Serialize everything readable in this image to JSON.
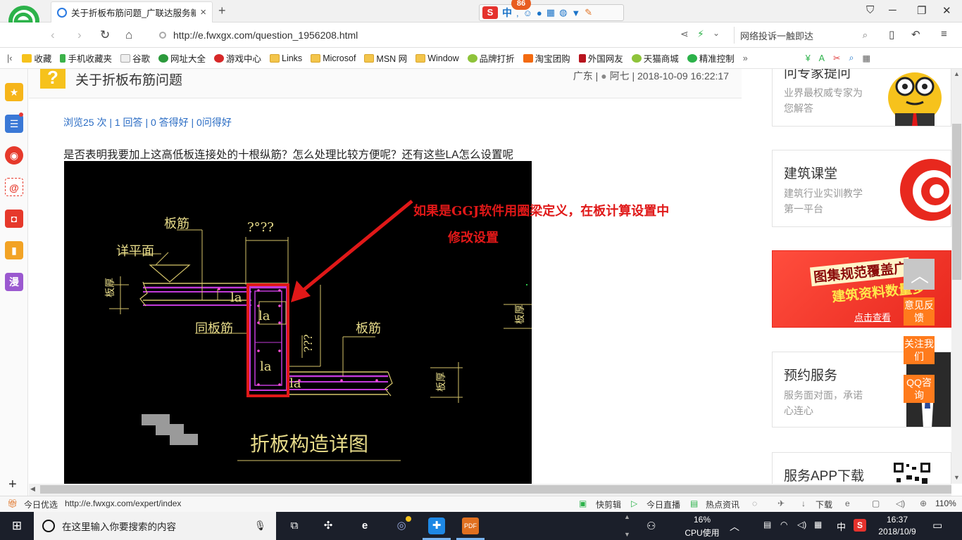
{
  "browser": {
    "tab_title": "关于折板布筋问题_广联达服务新",
    "tab_close": "×",
    "new_tab": "+",
    "ime_badge": "86",
    "ime_lang": "中",
    "url": "http://e.fwxgx.com/question_1956208.html",
    "search_text": "网络投诉一触即达",
    "zoom": "110%"
  },
  "bookmarks": [
    {
      "label": "收藏",
      "icon": "star-icon"
    },
    {
      "label": "手机收藏夹",
      "icon": "phone-icon"
    },
    {
      "label": "谷歌",
      "icon": "page-icon"
    },
    {
      "label": "网址大全",
      "icon": "globe-icon"
    },
    {
      "label": "游戏中心",
      "icon": "game-icon"
    },
    {
      "label": "Links",
      "icon": "folder-icon"
    },
    {
      "label": "Microsof",
      "icon": "folder-icon"
    },
    {
      "label": "MSN 网",
      "icon": "folder-icon"
    },
    {
      "label": "Window",
      "icon": "folder-icon"
    },
    {
      "label": "品牌打折",
      "icon": "leaf-icon"
    },
    {
      "label": "淘宝团购",
      "icon": "taobao-icon"
    },
    {
      "label": "外国网友",
      "icon": "flag-icon"
    },
    {
      "label": "天猫商城",
      "icon": "leaf-icon"
    },
    {
      "label": "精准控制",
      "icon": "wechat-icon"
    }
  ],
  "sidebar_left": {
    "manga_label": "漫"
  },
  "question": {
    "icon_char": "?",
    "title": "关于折板布筋问题",
    "region": "广东",
    "author": "阿七",
    "date": "2018-10-09 16:22:17",
    "stats": "浏览25 次 | 1 回答 | 0 答得好 | 0问得好",
    "text": "是否表明我要加上这高低板连接处的十根纵筋？怎么处理比较方便呢？还有这些LA怎么设置呢"
  },
  "drawing": {
    "label_banjin_top": "板筋",
    "label_xiangpingmian": "详平面",
    "label_tongbanjin": "同板筋",
    "label_banjin_right": "板筋",
    "label_dim_top": "?°??",
    "label_dim_mid": "???",
    "label_la1": "la",
    "label_la2": "la",
    "label_la3": "la",
    "label_la4": "la",
    "label_side_left": "板厚",
    "label_side_right": "板厚",
    "label_side_right2": "板厚",
    "caption": "折板构造详图",
    "annotation_line1": "如果是GGJ软件用圈梁定义，在板计算设置中",
    "annotation_line2": "修改设置"
  },
  "right_cards": [
    {
      "title": "问专家提问",
      "sub": "业界最权威专家为您解答"
    },
    {
      "title": "建筑课堂",
      "sub": "建筑行业实训教学第一平台"
    },
    {
      "title": "图集规范覆盖广",
      "title2": "建筑资料数量多",
      "sub": "点击查看"
    },
    {
      "title": "预约服务",
      "sub": "服务面对面，承诺心连心"
    },
    {
      "title": "服务APP下载"
    }
  ],
  "float_buttons": [
    {
      "label": "意见反馈"
    },
    {
      "label": "关注我们"
    },
    {
      "label": "QQ咨询"
    }
  ],
  "statusbar": {
    "today": "今日优选",
    "link": "http://e.fwxgx.com/expert/index",
    "items": [
      "快剪辑",
      "今日直播",
      "热点资讯",
      "下载"
    ]
  },
  "taskbar": {
    "search_placeholder": "在这里输入你要搜索的内容",
    "cpu_percent": "16%",
    "cpu_label": "CPU使用",
    "lang": "中",
    "time": "16:37",
    "date": "2018/10/9"
  },
  "colors": {
    "accent_orange": "#ff7b1c",
    "annotation_red": "#e01818",
    "link_blue": "#2a6cc4"
  }
}
